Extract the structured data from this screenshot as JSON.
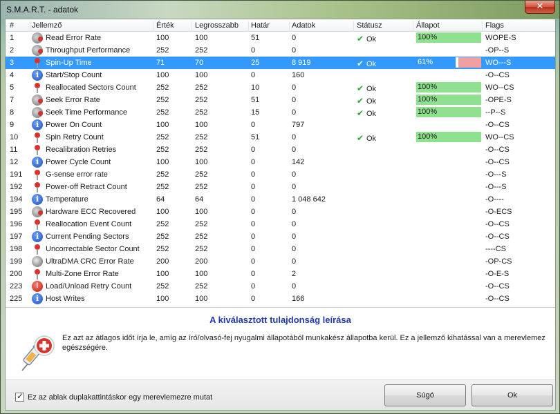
{
  "window": {
    "title": "S.M.A.R.T. - adatok",
    "close_label": "✕"
  },
  "table": {
    "headers": [
      "#",
      "Jellemző",
      "Érték",
      "Legrosszabb",
      "Határ",
      "Adatok",
      "Státusz",
      "Állapot",
      "Flags"
    ],
    "rows": [
      {
        "num": "1",
        "icon": "gear-icon",
        "name": "Read Error Rate",
        "value": "100",
        "worst": "100",
        "threshold": "51",
        "data": "0",
        "status": "Ok",
        "condition_label": "100%",
        "condition": 100,
        "flags": "WOPE-S"
      },
      {
        "num": "2",
        "icon": "gear-icon",
        "name": "Throughput Performance",
        "value": "252",
        "worst": "252",
        "threshold": "0",
        "data": "0",
        "status": "",
        "condition_label": "",
        "condition": null,
        "flags": "-OP--S"
      },
      {
        "num": "3",
        "icon": "pin-icon",
        "name": "Spin-Up Time",
        "value": "71",
        "worst": "70",
        "threshold": "25",
        "data": "8 919",
        "status": "Ok",
        "condition_label": "61%",
        "condition": 61,
        "flags": "WO---S",
        "selected": true
      },
      {
        "num": "4",
        "icon": "info-icon",
        "name": "Start/Stop Count",
        "value": "100",
        "worst": "100",
        "threshold": "0",
        "data": "160",
        "status": "",
        "condition_label": "",
        "condition": null,
        "flags": "-O--CS"
      },
      {
        "num": "5",
        "icon": "pin-icon",
        "name": "Reallocated Sectors Count",
        "value": "252",
        "worst": "252",
        "threshold": "10",
        "data": "0",
        "status": "Ok",
        "condition_label": "100%",
        "condition": 100,
        "flags": "WO--CS"
      },
      {
        "num": "7",
        "icon": "gear-icon",
        "name": "Seek Error Rate",
        "value": "252",
        "worst": "252",
        "threshold": "51",
        "data": "0",
        "status": "Ok",
        "condition_label": "100%",
        "condition": 100,
        "flags": "-OPE-S"
      },
      {
        "num": "8",
        "icon": "gear-icon",
        "name": "Seek Time Performance",
        "value": "252",
        "worst": "252",
        "threshold": "15",
        "data": "0",
        "status": "Ok",
        "condition_label": "100%",
        "condition": 100,
        "flags": "--P--S"
      },
      {
        "num": "9",
        "icon": "info-icon",
        "name": "Power On Count",
        "value": "100",
        "worst": "100",
        "threshold": "0",
        "data": "797",
        "status": "",
        "condition_label": "",
        "condition": null,
        "flags": "-O--CS"
      },
      {
        "num": "10",
        "icon": "pin-icon",
        "name": "Spin Retry Count",
        "value": "252",
        "worst": "252",
        "threshold": "51",
        "data": "0",
        "status": "Ok",
        "condition_label": "100%",
        "condition": 100,
        "flags": "WO--CS"
      },
      {
        "num": "11",
        "icon": "pin-icon",
        "name": "Recalibration Retries",
        "value": "252",
        "worst": "252",
        "threshold": "0",
        "data": "0",
        "status": "",
        "condition_label": "",
        "condition": null,
        "flags": "-O--CS"
      },
      {
        "num": "12",
        "icon": "info-icon",
        "name": "Power Cycle Count",
        "value": "100",
        "worst": "100",
        "threshold": "0",
        "data": "142",
        "status": "",
        "condition_label": "",
        "condition": null,
        "flags": "-O--CS"
      },
      {
        "num": "191",
        "icon": "pin-icon",
        "name": "G-sense error rate",
        "value": "252",
        "worst": "252",
        "threshold": "0",
        "data": "0",
        "status": "",
        "condition_label": "",
        "condition": null,
        "flags": "-O---S"
      },
      {
        "num": "192",
        "icon": "pin-icon",
        "name": "Power-off Retract Count",
        "value": "252",
        "worst": "252",
        "threshold": "0",
        "data": "0",
        "status": "",
        "condition_label": "",
        "condition": null,
        "flags": "-O---S"
      },
      {
        "num": "194",
        "icon": "info-icon",
        "name": "Temperature",
        "value": "64",
        "worst": "64",
        "threshold": "0",
        "data": "1 048 642",
        "status": "",
        "condition_label": "",
        "condition": null,
        "flags": "-O----"
      },
      {
        "num": "195",
        "icon": "gear-icon",
        "name": "Hardware ECC Recovered",
        "value": "100",
        "worst": "100",
        "threshold": "0",
        "data": "0",
        "status": "",
        "condition_label": "",
        "condition": null,
        "flags": "-O-ECS"
      },
      {
        "num": "196",
        "icon": "pin-icon",
        "name": "Reallocation Event Count",
        "value": "252",
        "worst": "252",
        "threshold": "0",
        "data": "0",
        "status": "",
        "condition_label": "",
        "condition": null,
        "flags": "-O--CS"
      },
      {
        "num": "197",
        "icon": "info-icon",
        "name": "Current Pending Sectors",
        "value": "252",
        "worst": "252",
        "threshold": "0",
        "data": "0",
        "status": "",
        "condition_label": "",
        "condition": null,
        "flags": "-O--CS"
      },
      {
        "num": "198",
        "icon": "pin-icon",
        "name": "Uncorrectable Sector Count",
        "value": "252",
        "worst": "252",
        "threshold": "0",
        "data": "0",
        "status": "",
        "condition_label": "",
        "condition": null,
        "flags": "----CS"
      },
      {
        "num": "199",
        "icon": "disc-icon",
        "name": "UltraDMA CRC Error Rate",
        "value": "200",
        "worst": "200",
        "threshold": "0",
        "data": "0",
        "status": "",
        "condition_label": "",
        "condition": null,
        "flags": "-OP-CS"
      },
      {
        "num": "200",
        "icon": "pin-icon",
        "name": "Multi-Zone Error Rate",
        "value": "100",
        "worst": "100",
        "threshold": "0",
        "data": "2",
        "status": "",
        "condition_label": "",
        "condition": null,
        "flags": "-O-E-S"
      },
      {
        "num": "223",
        "icon": "alert-icon",
        "name": "Load/Unload Retry Count",
        "value": "252",
        "worst": "252",
        "threshold": "0",
        "data": "0",
        "status": "",
        "condition_label": "",
        "condition": null,
        "flags": "-O--CS"
      },
      {
        "num": "225",
        "icon": "info-icon",
        "name": "Host Writes",
        "value": "100",
        "worst": "100",
        "threshold": "0",
        "data": "166",
        "status": "",
        "condition_label": "",
        "condition": null,
        "flags": "-O--CS"
      }
    ]
  },
  "description": {
    "title": "A kiválasztott tulajdonság leírása",
    "text": "Ez azt az átlagos időt írja le, amíg az író/olvasó-fej nyugalmi állapotából munkakész állapotba kerül.  Ez a jellemző kihatással van a merevlemez egészségére.",
    "icon": "medical-syringe-icon"
  },
  "footer": {
    "checkbox_label": "Ez az ablak duplakattintáskor egy merevlemezre mutat",
    "checkbox_checked": true,
    "help_label": "Súgó",
    "ok_label": "Ok"
  },
  "colors": {
    "selection": "#3399ff",
    "condition_good": "#8fe08f",
    "condition_bad": "#f0a0a0",
    "heading": "#1f3aa8"
  }
}
